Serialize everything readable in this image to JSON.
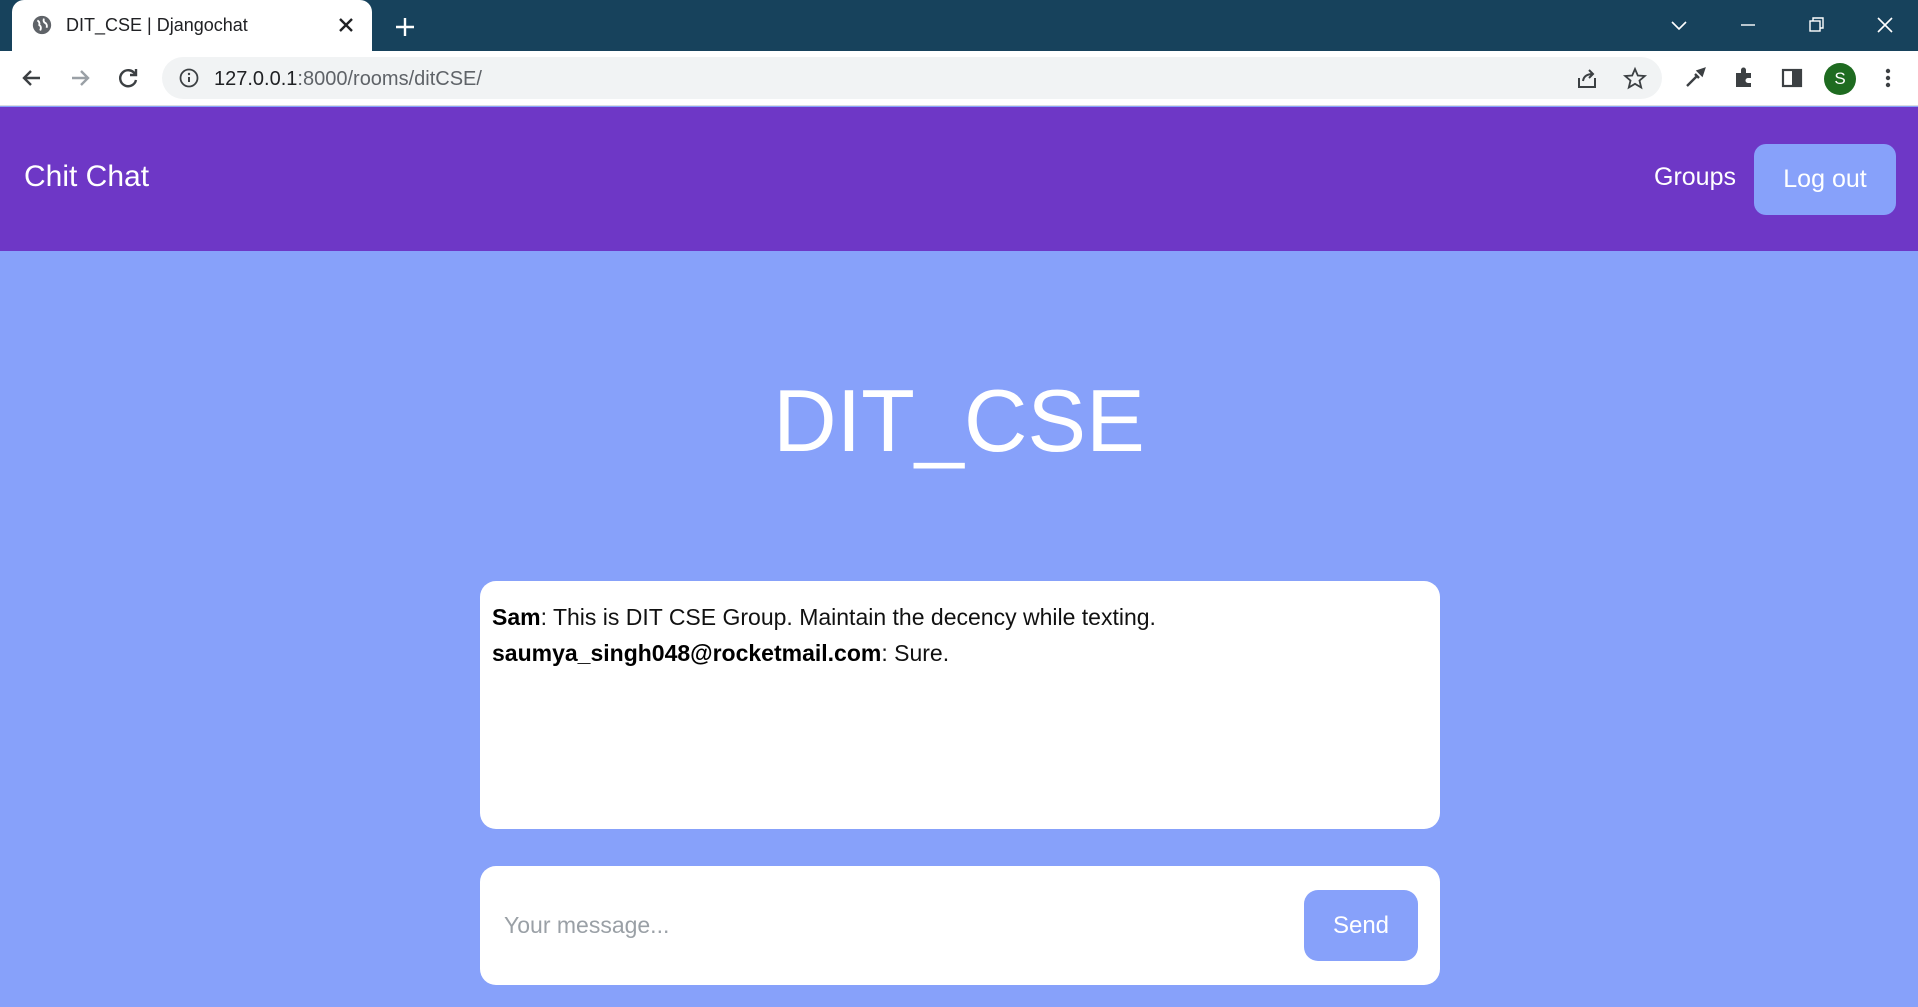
{
  "browser": {
    "tab_title": "DIT_CSE | Djangochat",
    "url_host": "127.0.0.1",
    "url_path": ":8000/rooms/ditCSE/",
    "profile_initial": "S"
  },
  "nav": {
    "brand": "Chit Chat",
    "groups_label": "Groups",
    "logout_label": "Log out"
  },
  "room": {
    "title": "DIT_CSE"
  },
  "messages": [
    {
      "author": "Sam",
      "text": ": This is DIT CSE Group. Maintain the decency while texting."
    },
    {
      "author": "saumya_singh048@rocketmail.com",
      "text": ": Sure."
    }
  ],
  "composer": {
    "placeholder": "Your message...",
    "send_label": "Send"
  },
  "colors": {
    "page_bg": "#87a1fa",
    "navbar_bg": "#6e37c6",
    "tabstrip_bg": "#17425c",
    "button_bg": "#87a1fa"
  }
}
